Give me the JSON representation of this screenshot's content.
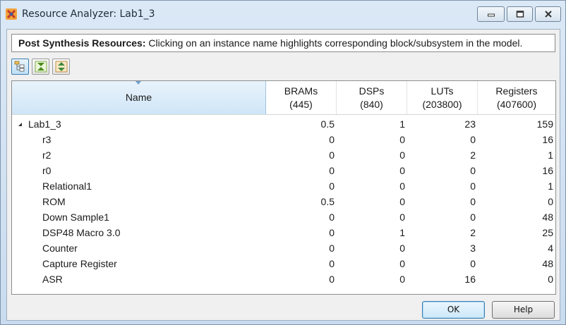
{
  "window": {
    "title": "Resource Analyzer: Lab1_3"
  },
  "banner": {
    "bold_text": "Post Synthesis Resources:",
    "text": " Clicking on an instance name highlights corresponding block/subsystem in the model."
  },
  "toolbar": {
    "buttons": [
      "tree-view",
      "collapse-all",
      "expand-all"
    ]
  },
  "table": {
    "columns": [
      {
        "label": "Name",
        "sub": ""
      },
      {
        "label": "BRAMs",
        "sub": "(445)"
      },
      {
        "label": "DSPs",
        "sub": "(840)"
      },
      {
        "label": "LUTs",
        "sub": "(203800)"
      },
      {
        "label": "Registers",
        "sub": "(407600)"
      }
    ],
    "rows": [
      {
        "name": "Lab1_3",
        "brams": "0.5",
        "dsps": "1",
        "luts": "23",
        "registers": "159"
      },
      {
        "name": "r3",
        "brams": "0",
        "dsps": "0",
        "luts": "0",
        "registers": "16"
      },
      {
        "name": "r2",
        "brams": "0",
        "dsps": "0",
        "luts": "2",
        "registers": "1"
      },
      {
        "name": "r0",
        "brams": "0",
        "dsps": "0",
        "luts": "0",
        "registers": "16"
      },
      {
        "name": "Relational1",
        "brams": "0",
        "dsps": "0",
        "luts": "0",
        "registers": "1"
      },
      {
        "name": "ROM",
        "brams": "0.5",
        "dsps": "0",
        "luts": "0",
        "registers": "0"
      },
      {
        "name": "Down Sample1",
        "brams": "0",
        "dsps": "0",
        "luts": "0",
        "registers": "48"
      },
      {
        "name": "DSP48 Macro 3.0",
        "brams": "0",
        "dsps": "1",
        "luts": "2",
        "registers": "25"
      },
      {
        "name": "Counter",
        "brams": "0",
        "dsps": "0",
        "luts": "3",
        "registers": "4"
      },
      {
        "name": "Capture Register",
        "brams": "0",
        "dsps": "0",
        "luts": "0",
        "registers": "48"
      },
      {
        "name": "ASR",
        "brams": "0",
        "dsps": "0",
        "luts": "16",
        "registers": "0"
      }
    ]
  },
  "buttons": {
    "ok": "OK",
    "help": "Help"
  }
}
